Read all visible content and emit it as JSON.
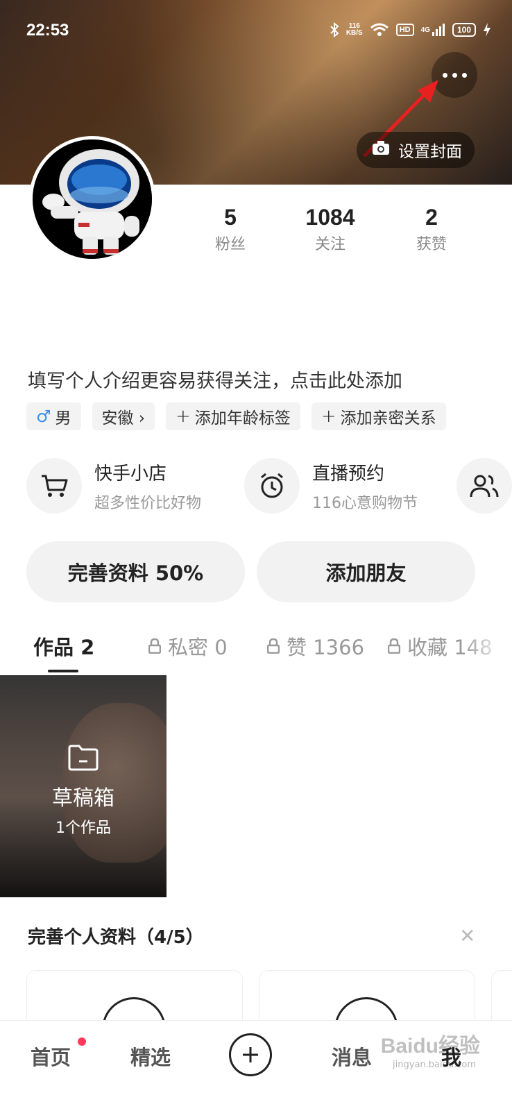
{
  "status_bar": {
    "time": "22:53",
    "speed": "116",
    "speed_unit": "KB/S",
    "hd": "HD",
    "network": "4G",
    "battery": "100"
  },
  "cover": {
    "set_cover_label": "设置封面"
  },
  "stats": [
    {
      "value": "5",
      "label": "粉丝"
    },
    {
      "value": "1084",
      "label": "关注"
    },
    {
      "value": "2",
      "label": "获赞"
    }
  ],
  "profile": {
    "intro_placeholder": "填写个人介绍更容易获得关注，点击此处添加",
    "tags": {
      "gender": "男",
      "region": "安徽 ›",
      "age": "添加年龄标签",
      "relation": "添加亲密关系"
    }
  },
  "shortcuts": [
    {
      "title": "快手小店",
      "subtitle": "超多性价比好物"
    },
    {
      "title": "直播预约",
      "subtitle": "116心意购物节"
    }
  ],
  "actions": {
    "complete_profile": "完善资料 50%",
    "add_friends": "添加朋友"
  },
  "tabs": [
    {
      "label": "作品 2"
    },
    {
      "label": "私密 0"
    },
    {
      "label": "赞 1366"
    },
    {
      "label": "收藏 148"
    }
  ],
  "draft": {
    "title": "草稿箱",
    "count": "1个作品"
  },
  "complete_panel": {
    "title": "完善个人资料（4/5）"
  },
  "bottom_nav": {
    "home": "首页",
    "featured": "精选",
    "messages": "消息",
    "me": "我"
  },
  "watermark": {
    "text": "Baidu经验",
    "sub": "jingyan.baidu.com"
  },
  "colors": {
    "accent_red": "#ff3b5c",
    "gender_blue": "#3e8ee8"
  }
}
